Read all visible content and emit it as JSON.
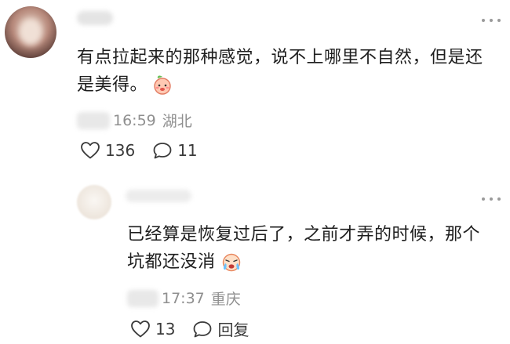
{
  "comments": [
    {
      "text": "有点拉起来的那种感觉，说不上哪里不自然，但是还是美得。",
      "emoji": "peach-face-emoji",
      "time": "16:59",
      "location": "湖北",
      "likes": "136",
      "replies": "11",
      "colors": {
        "avatar": "#c8a89a"
      }
    },
    {
      "text": "已经算是恢复过后了，之前才弄的时候，那个坑都还没消",
      "emoji": "crying-face-emoji",
      "time": "17:37",
      "location": "重庆",
      "likes": "13",
      "reply_label": "回复",
      "colors": {
        "avatar": "#f1ece6"
      }
    }
  ],
  "icons": {
    "like": "heart-outline-icon",
    "comment": "speech-bubble-icon",
    "more": "more-dots-icon"
  },
  "colors": {
    "text": "#1e1e1e",
    "meta": "#8f8f8f",
    "action": "#3a3a3a"
  }
}
